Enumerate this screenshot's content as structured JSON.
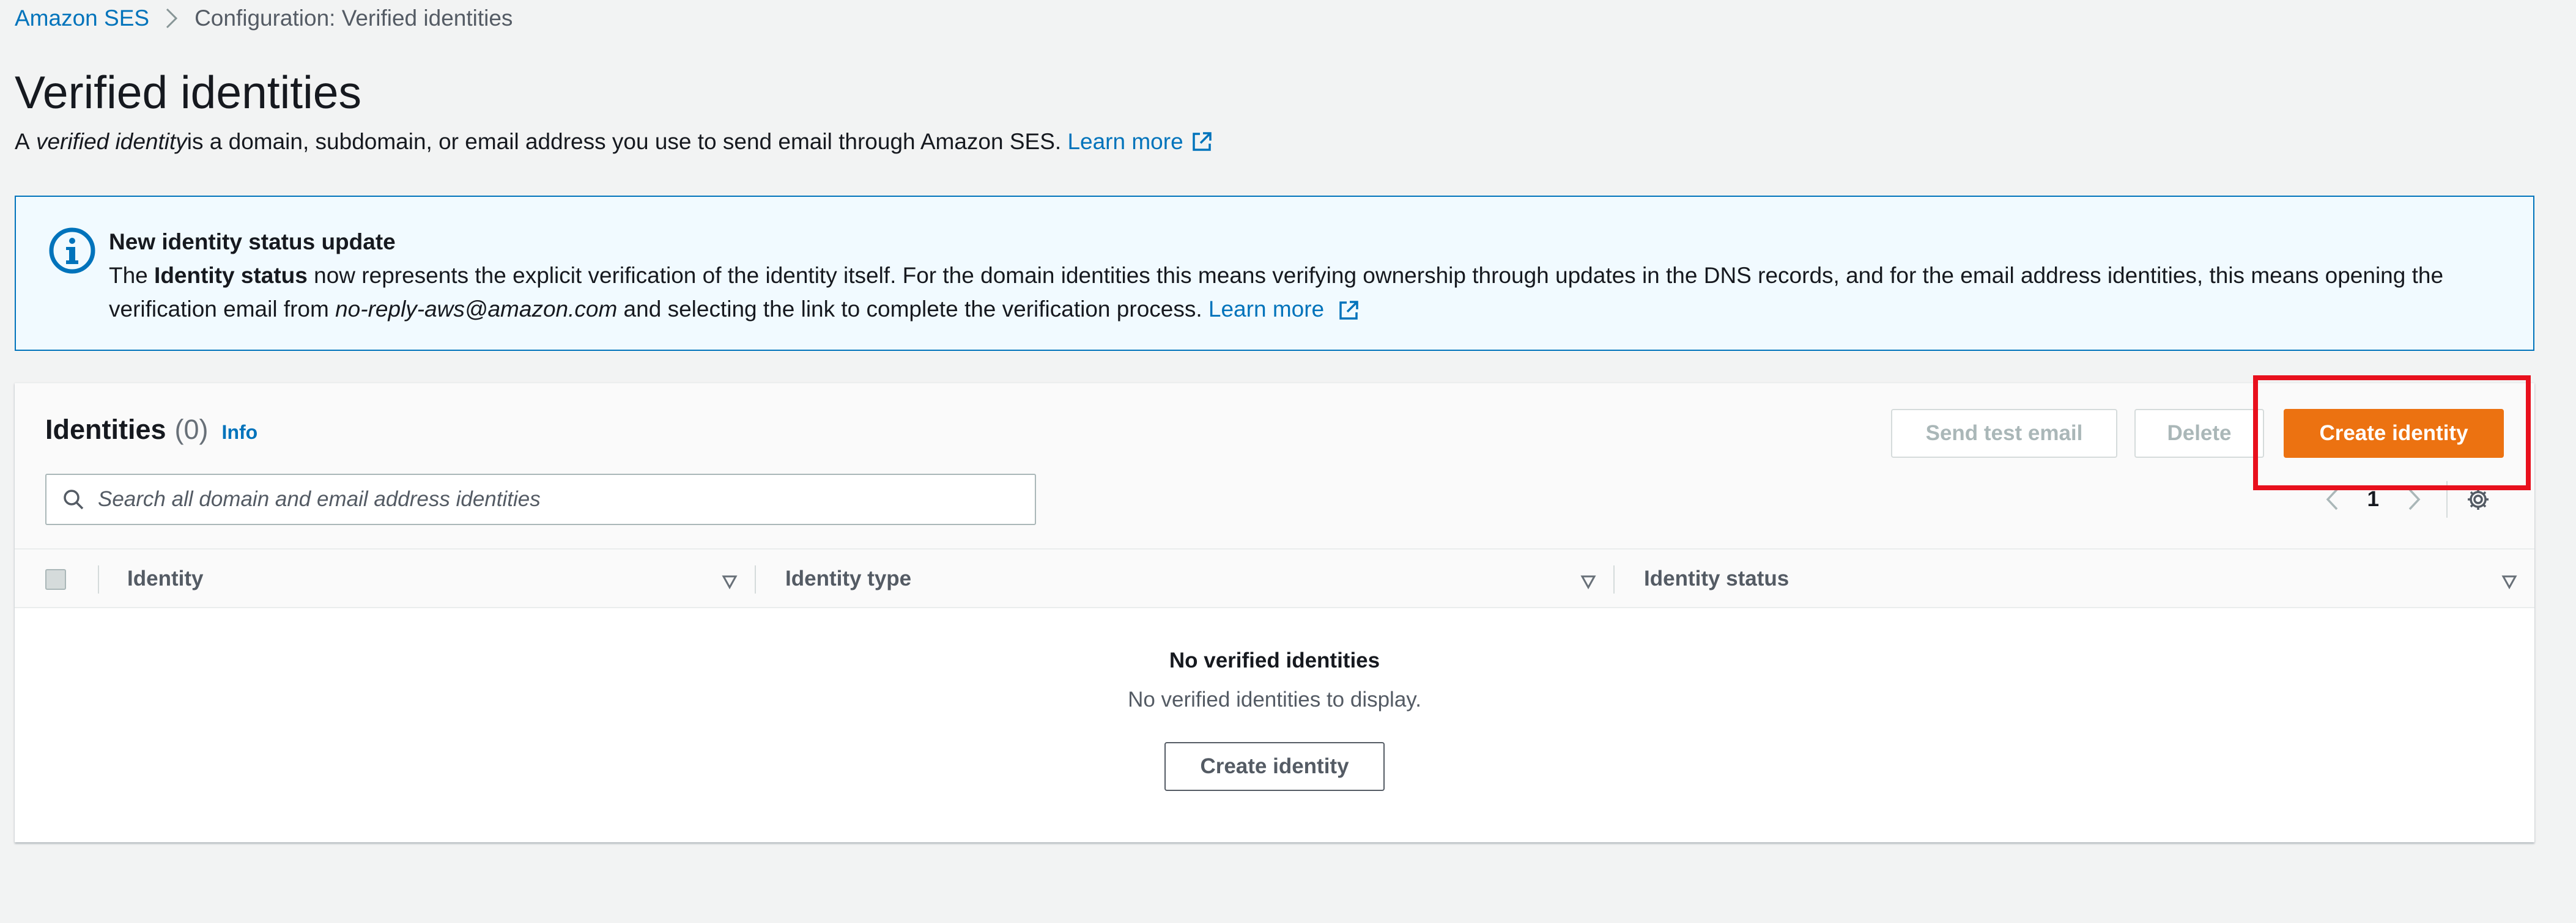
{
  "breadcrumb": {
    "root": "Amazon SES",
    "current": "Configuration: Verified identities"
  },
  "header": {
    "title": "Verified identities",
    "desc_prefix": "A ",
    "desc_em": "verified identity",
    "desc_suffix": " is a domain, subdomain, or email address you use to send email through Amazon SES. ",
    "learn_more": "Learn more"
  },
  "flash": {
    "icon": "info-icon",
    "title": "New identity status update",
    "text_the": "The ",
    "text_bold": "Identity status",
    "text_mid": " now represents the explicit verification of the identity itself. For the domain identities this means verifying ownership through updates in the DNS records, and for the email address identities, this means opening the verification email from ",
    "text_em": "no-reply-aws@amazon.com",
    "text_end": " and selecting the link to complete the verification process. ",
    "learn_more": "Learn more"
  },
  "identities": {
    "title": "Identities",
    "count": "(0)",
    "info": "Info",
    "send_test_email": "Send test email",
    "delete": "Delete",
    "create_identity": "Create identity",
    "search_placeholder": "Search all domain and email address identities",
    "page": "1",
    "columns": [
      "Identity",
      "Identity type",
      "Identity status"
    ],
    "empty_title": "No verified identities",
    "empty_sub": "No verified identities to display.",
    "empty_button": "Create identity"
  },
  "colors": {
    "primary": "#ec7211",
    "link": "#0073bb",
    "highlight": "#e8101d"
  }
}
